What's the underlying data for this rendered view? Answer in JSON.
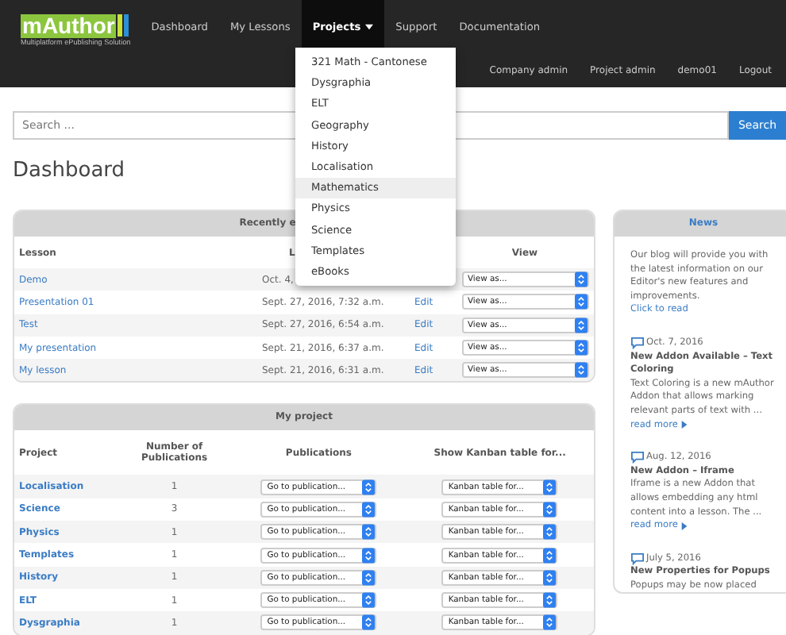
{
  "logo": {
    "name": "mAuthor",
    "tagline": "Multiplatform ePublishing Solution"
  },
  "nav": [
    {
      "label": "Dashboard",
      "selected": false,
      "dropdown": false
    },
    {
      "label": "My Lessons",
      "selected": false,
      "dropdown": false
    },
    {
      "label": "Projects",
      "selected": true,
      "dropdown": true
    },
    {
      "label": "Support",
      "selected": false,
      "dropdown": false
    },
    {
      "label": "Documentation",
      "selected": false,
      "dropdown": false
    }
  ],
  "user_nav": [
    "Company admin",
    "Project admin",
    "demo01",
    "Logout"
  ],
  "projects_menu": [
    {
      "label": "321 Math - Cantonese",
      "selected": false
    },
    {
      "label": "Dysgraphia",
      "selected": false
    },
    {
      "label": "ELT",
      "selected": false
    },
    {
      "label": "Geography",
      "selected": false
    },
    {
      "label": "History",
      "selected": false
    },
    {
      "label": "Localisation",
      "selected": false
    },
    {
      "label": "Mathematics",
      "selected": true
    },
    {
      "label": "Physics",
      "selected": false
    },
    {
      "label": "Science",
      "selected": false
    },
    {
      "label": "Templates",
      "selected": false
    },
    {
      "label": "eBooks",
      "selected": false
    }
  ],
  "search": {
    "placeholder": "Search ...",
    "button": "Search"
  },
  "page_title": "Dashboard",
  "recent": {
    "title": "Recently e",
    "columns": [
      "Lesson",
      "L",
      "View"
    ],
    "rows": [
      {
        "lesson": "Demo",
        "date": "Oct. 4,",
        "action": "",
        "view": "View as..."
      },
      {
        "lesson": "Presentation 01",
        "date": "Sept. 27, 2016, 7:32 a.m.",
        "action": "Edit",
        "view": "View as..."
      },
      {
        "lesson": "Test",
        "date": "Sept. 27, 2016, 6:54 a.m.",
        "action": "Edit",
        "view": "View as..."
      },
      {
        "lesson": "My presentation",
        "date": "Sept. 21, 2016, 6:37 a.m.",
        "action": "Edit",
        "view": "View as..."
      },
      {
        "lesson": "My lesson",
        "date": "Sept. 21, 2016, 6:31 a.m.",
        "action": "Edit",
        "view": "View as..."
      }
    ]
  },
  "projects": {
    "title": "My project",
    "columns": [
      "Project",
      "Number of Publications",
      "Publications",
      "Show Kanban table for..."
    ],
    "rows": [
      {
        "name": "Localisation",
        "count": "1",
        "publication": "Go to publication...",
        "kanban": "Kanban table for..."
      },
      {
        "name": "Science",
        "count": "3",
        "publication": "Go to publication...",
        "kanban": "Kanban table for..."
      },
      {
        "name": "Physics",
        "count": "1",
        "publication": "Go to publication...",
        "kanban": "Kanban table for..."
      },
      {
        "name": "Templates",
        "count": "1",
        "publication": "Go to publication...",
        "kanban": "Kanban table for..."
      },
      {
        "name": "History",
        "count": "1",
        "publication": "Go to publication...",
        "kanban": "Kanban table for..."
      },
      {
        "name": "ELT",
        "count": "1",
        "publication": "Go to publication...",
        "kanban": "Kanban table for..."
      },
      {
        "name": "Dysgraphia",
        "count": "1",
        "publication": "Go to publication...",
        "kanban": "Kanban table for..."
      }
    ]
  },
  "news": {
    "title": "News",
    "intro": "Our blog will provide you with the latest information on our Editor's new features and improvements.",
    "intro_link": "Click to read",
    "items": [
      {
        "date": "Oct. 7, 2016",
        "title": "New Addon Available – Text Coloring",
        "text": "Text Coloring is a new mAuthor Addon that allows marking relevant parts of text with ...",
        "more": "read more"
      },
      {
        "date": "Aug. 12, 2016",
        "title": "New Addon – Iframe",
        "text": "Iframe is a new Addon that allows embedding any html content into a lesson. The ...",
        "more": "read more"
      },
      {
        "date": "July 5, 2016",
        "title": "New Properties for Popups",
        "text": "Popups may be now placed"
      }
    ]
  }
}
